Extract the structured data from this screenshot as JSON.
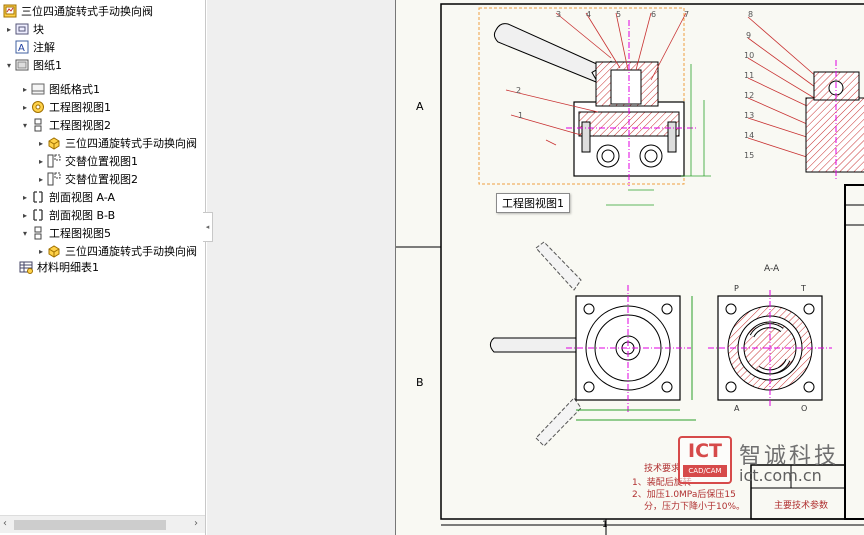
{
  "tree": {
    "root": "三位四通旋转式手动换向阀",
    "items": [
      {
        "label": "块"
      },
      {
        "label": "注解"
      },
      {
        "label": "图纸1"
      },
      {
        "label": "图纸格式1"
      },
      {
        "label": "工程图视图1"
      },
      {
        "label": "工程图视图2"
      },
      {
        "label": "三位四通旋转式手动换向阀"
      },
      {
        "label": "交替位置视图1"
      },
      {
        "label": "交替位置视图2"
      },
      {
        "label": "剖面视图 A-A"
      },
      {
        "label": "剖面视图 B-B"
      },
      {
        "label": "工程图视图5"
      },
      {
        "label": "三位四通旋转式手动换向阀"
      },
      {
        "label": "材料明细表1"
      }
    ]
  },
  "sheet": {
    "zone_a": "A",
    "zone_b": "B",
    "zone_1": "1",
    "view_tooltip": "工程图视图1",
    "section_label": "A-A",
    "balloons": [
      "1",
      "2",
      "3",
      "4",
      "5",
      "6",
      "7",
      "8",
      "9",
      "10",
      "11",
      "12",
      "13",
      "14",
      "15"
    ],
    "port_labels": {
      "p": "P",
      "t": "T",
      "a": "A",
      "o": "O"
    },
    "tech_notes": {
      "title": "技术要求",
      "line1": "1、装配后旋转",
      "line2": "2、加压1.0MPa后保压15",
      "line3": "分，压力下降小于10%。"
    },
    "param_title": "主要技术参数"
  },
  "watermark": {
    "logo_text": "ICT",
    "logo_sub": "CAD/CAM",
    "cn_text": "智诚科技",
    "url": "ict.com.cn"
  },
  "colors": {
    "sheet_bg": "#f9f9f3",
    "magenta": "#e000e0",
    "red": "#c83232",
    "green": "#2aa02a",
    "selection": "#f2a040"
  }
}
